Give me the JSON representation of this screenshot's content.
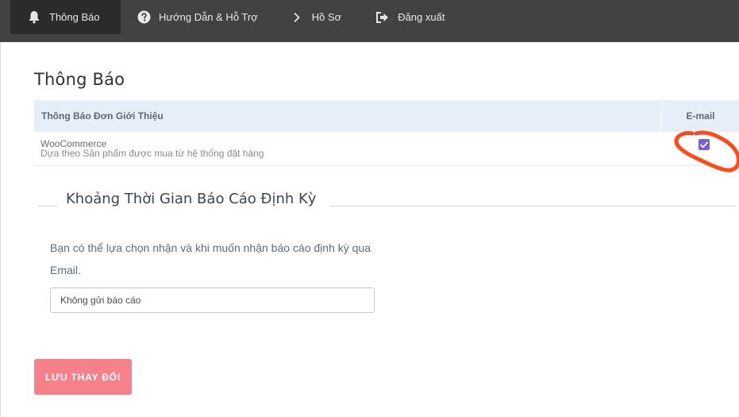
{
  "nav": {
    "items": [
      {
        "label": "Thông Báo",
        "icon": "bell-icon",
        "active": true
      },
      {
        "label": "Hướng Dẫn & Hỗ Trợ",
        "icon": "question-circle-icon",
        "active": false
      },
      {
        "label": "Hồ Sơ",
        "icon": "chevron-right-icon",
        "active": false
      },
      {
        "label": "Đăng xuất",
        "icon": "sign-out-icon",
        "active": false
      }
    ]
  },
  "page": {
    "title": "Thông Báo"
  },
  "notifications_table": {
    "columns": [
      "Thông Báo Đơn Giới Thiệu",
      "E-mail"
    ],
    "rows": [
      {
        "title": "WooCommerce",
        "description": "Dựa theo Sản phẩm được mua từ hệ thống đặt hàng",
        "email_checked": true
      }
    ]
  },
  "report_section": {
    "title": "Khoảng Thời Gian Báo Cáo Định Kỳ",
    "help_text": "Bạn có thể lựa chọn nhận và khi muốn nhận báo cáo định kỳ qua Email.",
    "select_value": "Không gửi báo cáo"
  },
  "actions": {
    "save_label": "LƯU THAY ĐỔI"
  },
  "colors": {
    "topbar": "#424242",
    "topbar_active": "#2b2b2b",
    "table_header": "#e6eff9",
    "checkbox": "#7b5fc9",
    "save_button": "#f6818a",
    "annotation": "#ff4a1c"
  }
}
